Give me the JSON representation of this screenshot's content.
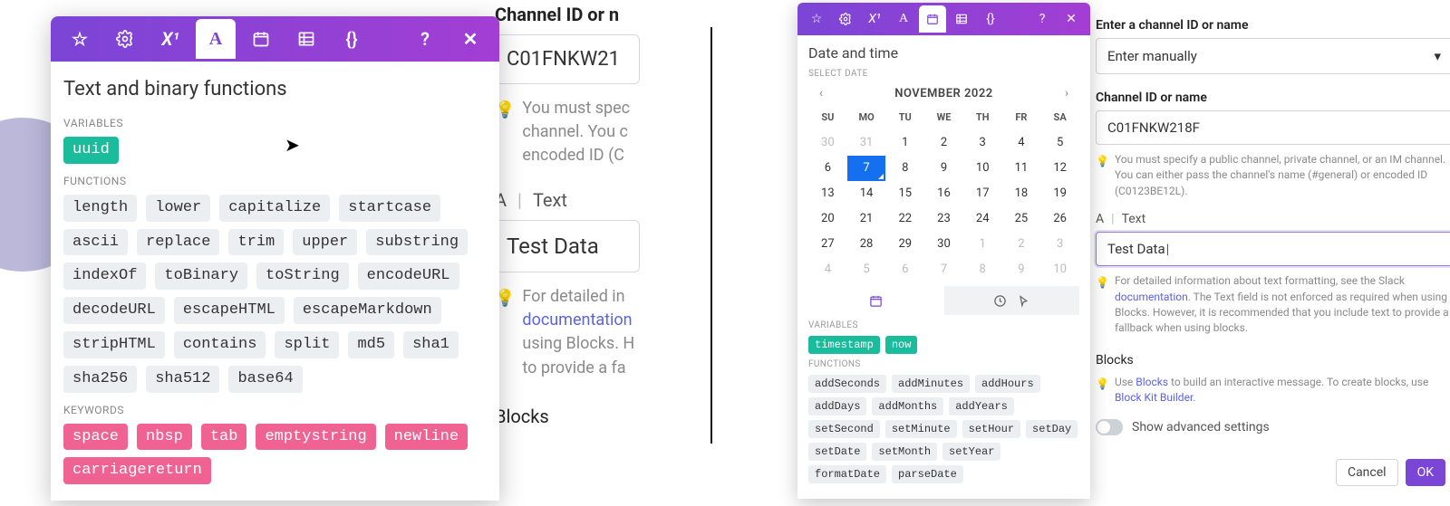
{
  "left": {
    "title": "Text and binary functions",
    "sections": {
      "variables_label": "VARIABLES",
      "functions_label": "FUNCTIONS",
      "keywords_label": "KEYWORDS"
    },
    "variables": [
      "uuid"
    ],
    "functions": [
      "length",
      "lower",
      "capitalize",
      "startcase",
      "ascii",
      "replace",
      "trim",
      "upper",
      "substring",
      "indexOf",
      "toBinary",
      "toString",
      "encodeURL",
      "decodeURL",
      "escapeHTML",
      "escapeMarkdown",
      "stripHTML",
      "contains",
      "split",
      "md5",
      "sha1",
      "sha256",
      "sha512",
      "base64"
    ],
    "keywords": [
      "space",
      "nbsp",
      "tab",
      "emptystring",
      "newline",
      "carriagereturn"
    ],
    "bg": {
      "field_label": "Channel ID or n",
      "field_value": "C01FNKW21",
      "hint": "You must spec\nchannel. You c\nencoded ID (C",
      "text_section_a": "A",
      "text_section_label": "Text",
      "text_value": "Test Data",
      "text_hint_pre": "For detailed in",
      "text_hint_link": "documentation",
      "text_hint_post": "using Blocks. H\nto provide a fa",
      "blocks_label": "Blocks"
    }
  },
  "right": {
    "title": "Date and time",
    "select_date_label": "SELECT DATE",
    "month": "NOVEMBER 2022",
    "dow": [
      "SU",
      "MO",
      "TU",
      "WE",
      "TH",
      "FR",
      "SA"
    ],
    "grid": [
      {
        "d": 30,
        "m": true
      },
      {
        "d": 31,
        "m": true
      },
      {
        "d": 1
      },
      {
        "d": 2
      },
      {
        "d": 3
      },
      {
        "d": 4
      },
      {
        "d": 5
      },
      {
        "d": 6
      },
      {
        "d": 7,
        "sel": true
      },
      {
        "d": 8
      },
      {
        "d": 9
      },
      {
        "d": 10
      },
      {
        "d": 11
      },
      {
        "d": 12
      },
      {
        "d": 13
      },
      {
        "d": 14
      },
      {
        "d": 15
      },
      {
        "d": 16
      },
      {
        "d": 17
      },
      {
        "d": 18
      },
      {
        "d": 19
      },
      {
        "d": 20
      },
      {
        "d": 21
      },
      {
        "d": 22
      },
      {
        "d": 23
      },
      {
        "d": 24
      },
      {
        "d": 25
      },
      {
        "d": 26
      },
      {
        "d": 27
      },
      {
        "d": 28
      },
      {
        "d": 29
      },
      {
        "d": 30
      },
      {
        "d": 1,
        "m": true
      },
      {
        "d": 2,
        "m": true
      },
      {
        "d": 3,
        "m": true
      },
      {
        "d": 4,
        "m": true
      },
      {
        "d": 5,
        "m": true
      },
      {
        "d": 6,
        "m": true
      },
      {
        "d": 7,
        "m": true
      },
      {
        "d": 8,
        "m": true
      },
      {
        "d": 9,
        "m": true
      },
      {
        "d": 10,
        "m": true
      }
    ],
    "variables_label": "VARIABLES",
    "functions_label": "FUNCTIONS",
    "variables": [
      "timestamp",
      "now"
    ],
    "functions": [
      "addSeconds",
      "addMinutes",
      "addHours",
      "addDays",
      "addMonths",
      "addYears",
      "setSecond",
      "setMinute",
      "setHour",
      "setDay",
      "setDate",
      "setMonth",
      "setYear",
      "formatDate",
      "parseDate"
    ],
    "bg": {
      "enter_label": "Enter a channel ID or name",
      "select_value": "Enter manually",
      "field_label": "Channel ID or name",
      "field_value": "C01FNKW218F",
      "hint1": "You must specify a public channel, private channel, or an IM channel. You can either pass the channel's name (#general) or encoded ID (C0123BE12L).",
      "text_section_a": "A",
      "text_section_label": "Text",
      "text_value": "Test Data",
      "hint2_pre": "For detailed information about text formatting, see the Slack ",
      "hint2_link": "documentation",
      "hint2_post": ". The Text field is not enforced as required when using Blocks. However, it is recommended that you include text to provide a fallback when using blocks.",
      "blocks_label": "Blocks",
      "hint3_pre": "Use ",
      "hint3_link1": "Blocks",
      "hint3_mid": " to build an interactive message. To create blocks, use ",
      "hint3_link2": "Block Kit Builder",
      "hint3_post": ".",
      "show_adv": "Show advanced settings",
      "cancel": "Cancel",
      "ok": "OK"
    }
  }
}
